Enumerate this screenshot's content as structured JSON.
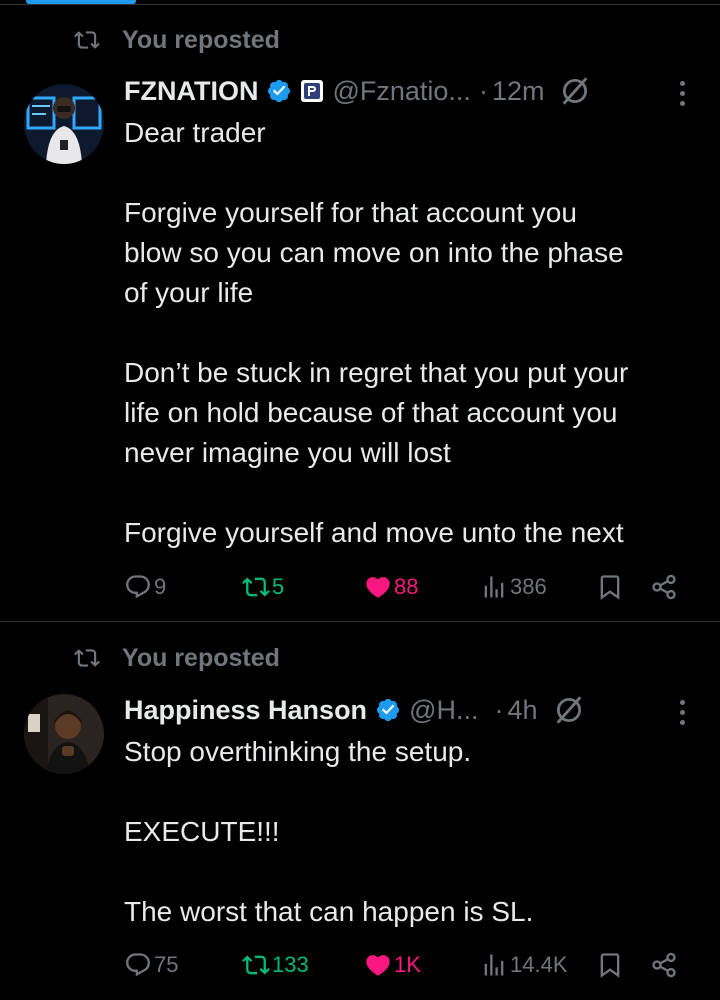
{
  "tweets": [
    {
      "repost_label": "You reposted",
      "name": "FZNATION",
      "handle": "@Fznatio...",
      "sep": "·",
      "time": "12m",
      "lines": [
        "Dear trader",
        "",
        "Forgive yourself for that account you",
        "blow so you can move on into the phase",
        "of your life",
        "",
        "Don’t be stuck in regret that you put your",
        "life on hold because of that account you",
        "never imagine you will lost",
        "",
        "Forgive yourself and move unto the next"
      ],
      "replies": "9",
      "reposts": "5",
      "likes": "88",
      "views": "386"
    },
    {
      "repost_label": "You reposted",
      "name": "Happiness Hanson",
      "handle": "@H...",
      "sep": "·",
      "time": "4h",
      "lines": [
        "Stop overthinking the setup.",
        "",
        "EXECUTE!!!",
        "",
        "The worst that can happen is SL."
      ],
      "replies": "75",
      "reposts": "133",
      "likes": "1K",
      "views": "14.4K"
    }
  ],
  "icons": [
    "repost-icon",
    "verified-badge-icon",
    "affiliate-badge-icon",
    "grok-icon",
    "more-icon",
    "reply-icon",
    "like-icon",
    "views-icon",
    "bookmark-icon",
    "share-icon"
  ],
  "colors": {
    "background": "#000000",
    "text": "#e7e9ea",
    "muted": "#71767b",
    "accent": "#1d9bf0",
    "repost": "#00ba7c",
    "like": "#f91880"
  }
}
